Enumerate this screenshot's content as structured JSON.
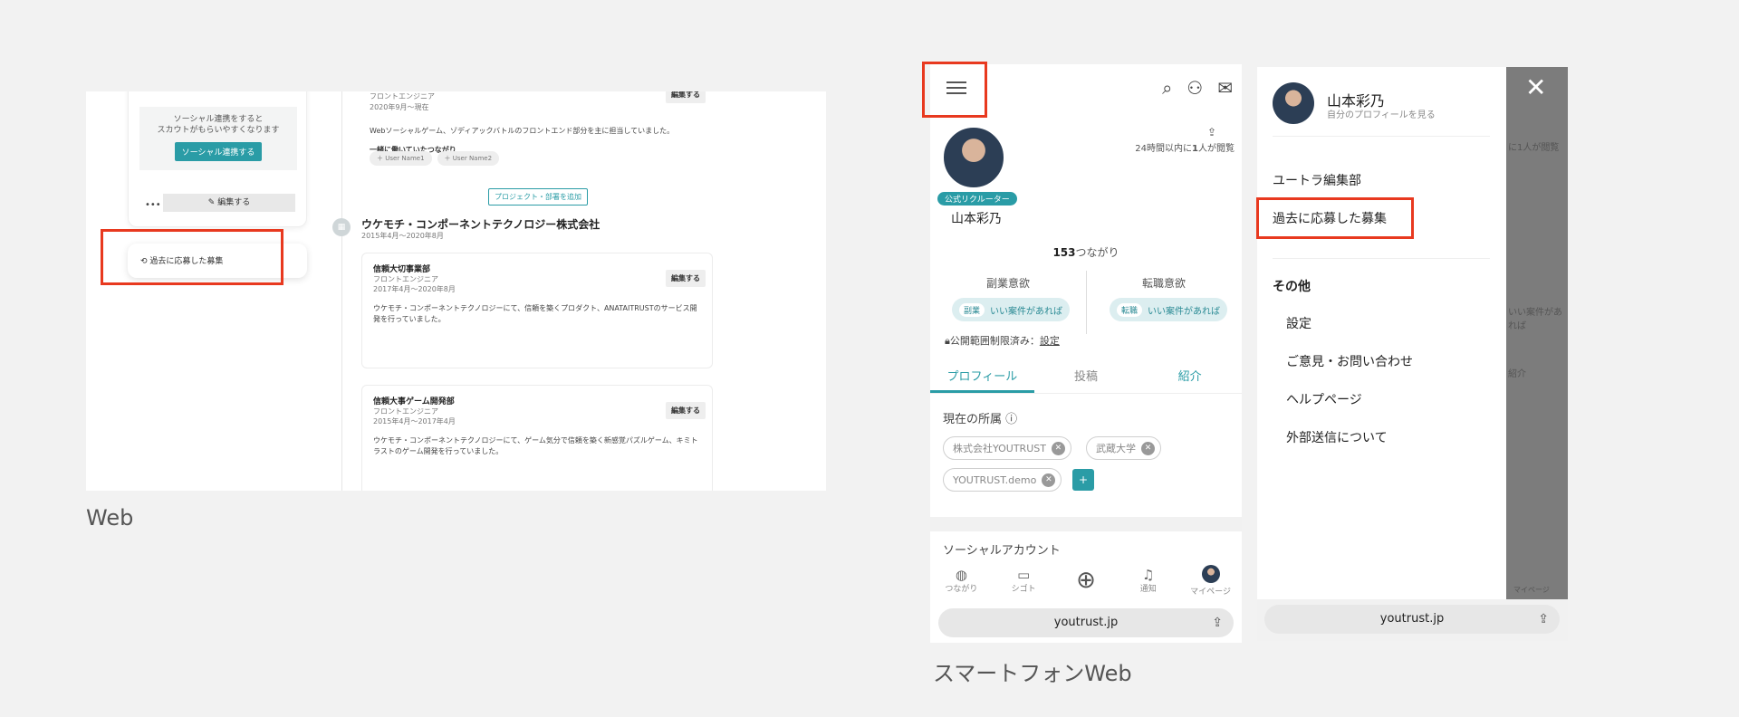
{
  "captions": {
    "web": "Web",
    "smartphone": "スマートフォンWeb"
  },
  "web": {
    "top_job_title": "フロントエンジニア",
    "top_job_period": "2020年9月〜現在",
    "top_job_desc": "Webソーシャルゲーム、ゾディアックバトルのフロントエンド部分を主に担当していました。",
    "coworkers_label": "一緒に働いていたつながり",
    "user_chips": [
      "User Name1",
      "User Name2"
    ],
    "social_line1": "ソーシャル連携をすると",
    "social_line2": "スカウトがもらいやすくなります",
    "social_button": "ソーシャル連携する",
    "more_icon": "•••",
    "edit_bar_label": "編集する",
    "edit_label": "編集する",
    "applied_link": "過去に応募した募集",
    "add_project": "プロジェクト・部署を追加",
    "company_name": "ウケモチ・コンポーネントテクノロジー株式会社",
    "company_period": "2015年4月〜2020年8月",
    "jobs": [
      {
        "title": "信頼大切事業部",
        "role": "フロントエンジニア",
        "period": "2017年4月〜2020年8月",
        "desc": "ウケモチ・コンポーネントテクノロジーにて、信頼を築くプロダクト、ANATAITRUSTのサービス開発を行っていました。"
      },
      {
        "title": "信頼大事ゲーム開発部",
        "role": "フロントエンジニア",
        "period": "2015年4月〜2017年4月",
        "desc": "ウケモチ・コンポーネントテクノロジーにて、ゲーム気分で信頼を築く新感覚パズルゲーム、キミトラストのゲーム開発を行っていました。"
      }
    ]
  },
  "phone1": {
    "badge": "公式リクルーター",
    "name": "山本彩乃",
    "view_count_prefix": "24時間以内に",
    "view_count_num": "1",
    "view_count_suffix": "人が閲覧",
    "connections_num": "153",
    "connections_label": "つながり",
    "side_job_label": "副業意欲",
    "side_job_tag": "副業",
    "side_job_value": "いい案件があれば",
    "career_label": "転職意欲",
    "career_tag": "転職",
    "career_value": "いい案件があれば",
    "privacy_label": "公開範囲制限済み：",
    "privacy_link": "設定",
    "tabs": [
      "プロフィール",
      "投稿",
      "紹介"
    ],
    "affiliation_title": "現在の所属",
    "affiliations": [
      "株式会社YOUTRUST",
      "武蔵大学",
      "YOUTRUST.demo"
    ],
    "add_label": "+",
    "social_title": "ソーシャルアカウント",
    "nav": [
      "つながり",
      "シゴト",
      "",
      "通知",
      "マイページ"
    ],
    "url": "youtrust.jp"
  },
  "phone2": {
    "name": "山本彩乃",
    "sub": "自分のプロフィールを見る",
    "menu1": "ユートラ編集部",
    "menu2": "過去に応募した募集",
    "section": "その他",
    "items": [
      "設定",
      "ご意見・お問い合わせ",
      "ヘルプページ",
      "外部送信について"
    ],
    "ghost_views": "に1人が閲覧",
    "ghost_pill": "いい案件があれば",
    "ghost_tab": "紹介",
    "ghost_nav": "マイページ",
    "url": "youtrust.jp"
  }
}
